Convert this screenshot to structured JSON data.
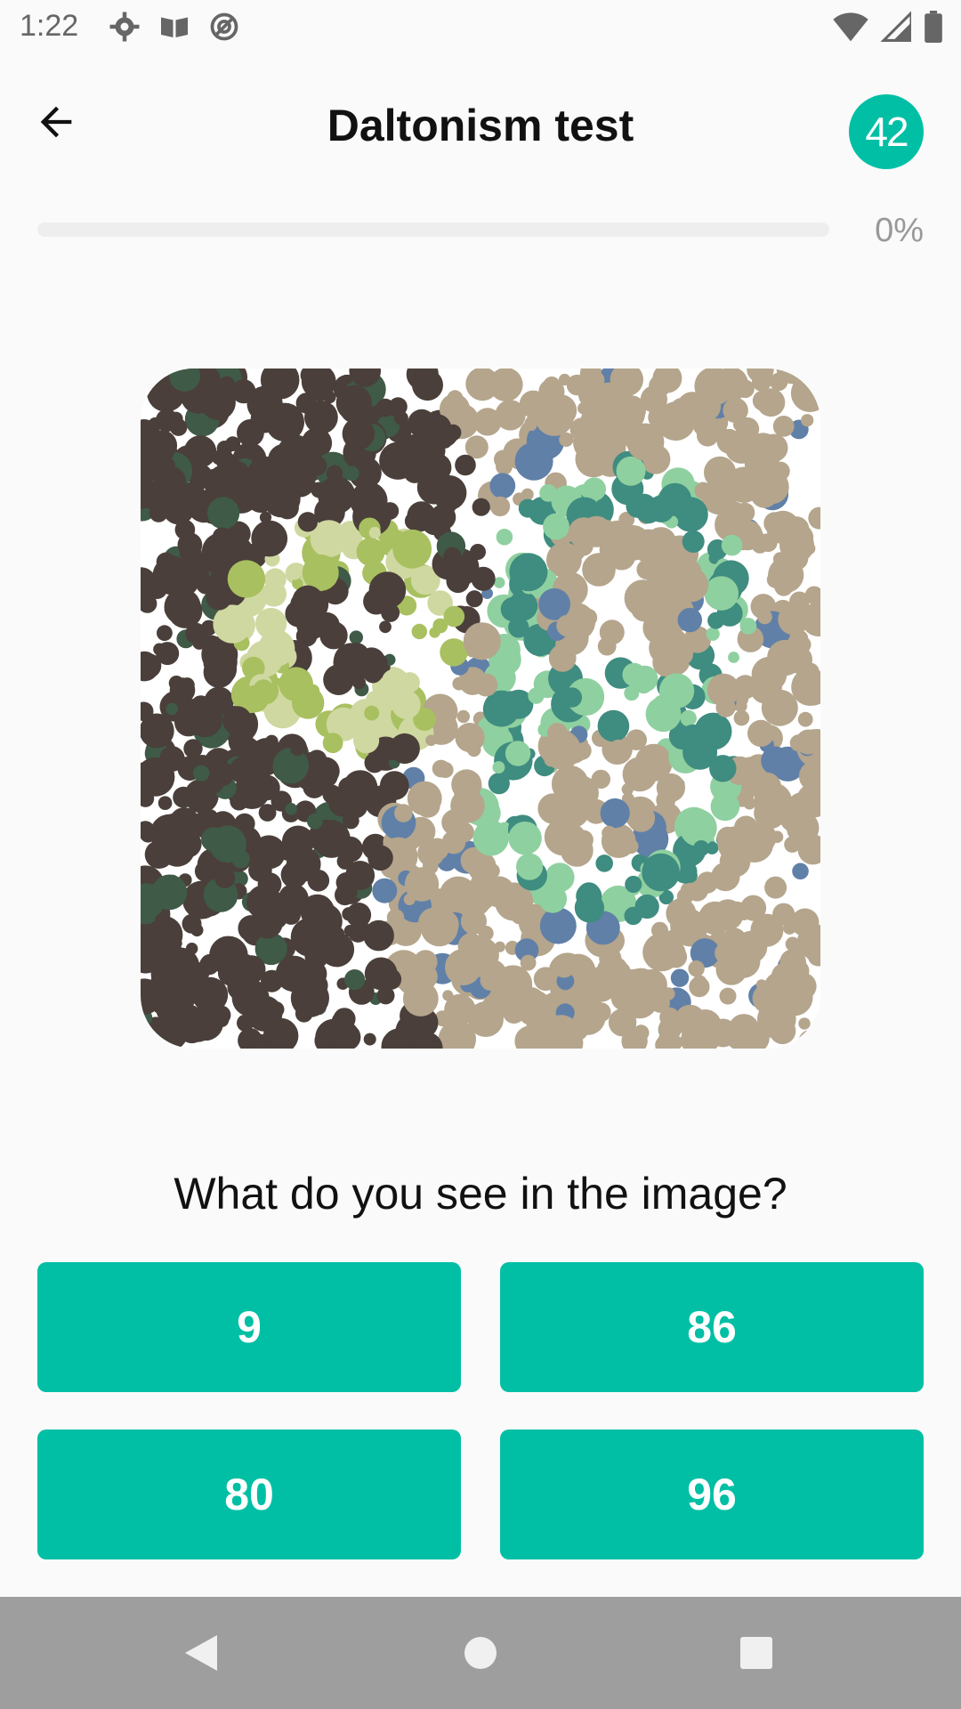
{
  "status_bar": {
    "time": "1:22",
    "left_icons": [
      "gear-icon",
      "book-icon",
      "at-sign-icon"
    ],
    "right_icons": [
      "wifi-icon",
      "signal-icon",
      "battery-icon"
    ]
  },
  "app_bar": {
    "back_icon": "arrow-left-icon",
    "title": "Daltonism test",
    "badge": "42"
  },
  "progress": {
    "value": 0,
    "label": "0%"
  },
  "plate": {
    "image": "ishihara-color-plate",
    "colors": {
      "dark": "#4a3f3a",
      "darkgreen": "#3f5a47",
      "green": "#a8c060",
      "lightgreen": "#cfd8a0",
      "tan": "#b4a58c",
      "teal": "#3f8c80",
      "mint": "#8fd0a0",
      "blue": "#6080a8"
    }
  },
  "question": "What do you see in the image?",
  "answers": [
    "9",
    "86",
    "80",
    "96"
  ],
  "colors": {
    "accent": "#00bfa5",
    "nav_bar": "#9e9e9e",
    "background": "#fafafa"
  },
  "nav_bar": {
    "buttons": [
      "back-triangle-icon",
      "home-circle-icon",
      "recents-square-icon"
    ]
  }
}
